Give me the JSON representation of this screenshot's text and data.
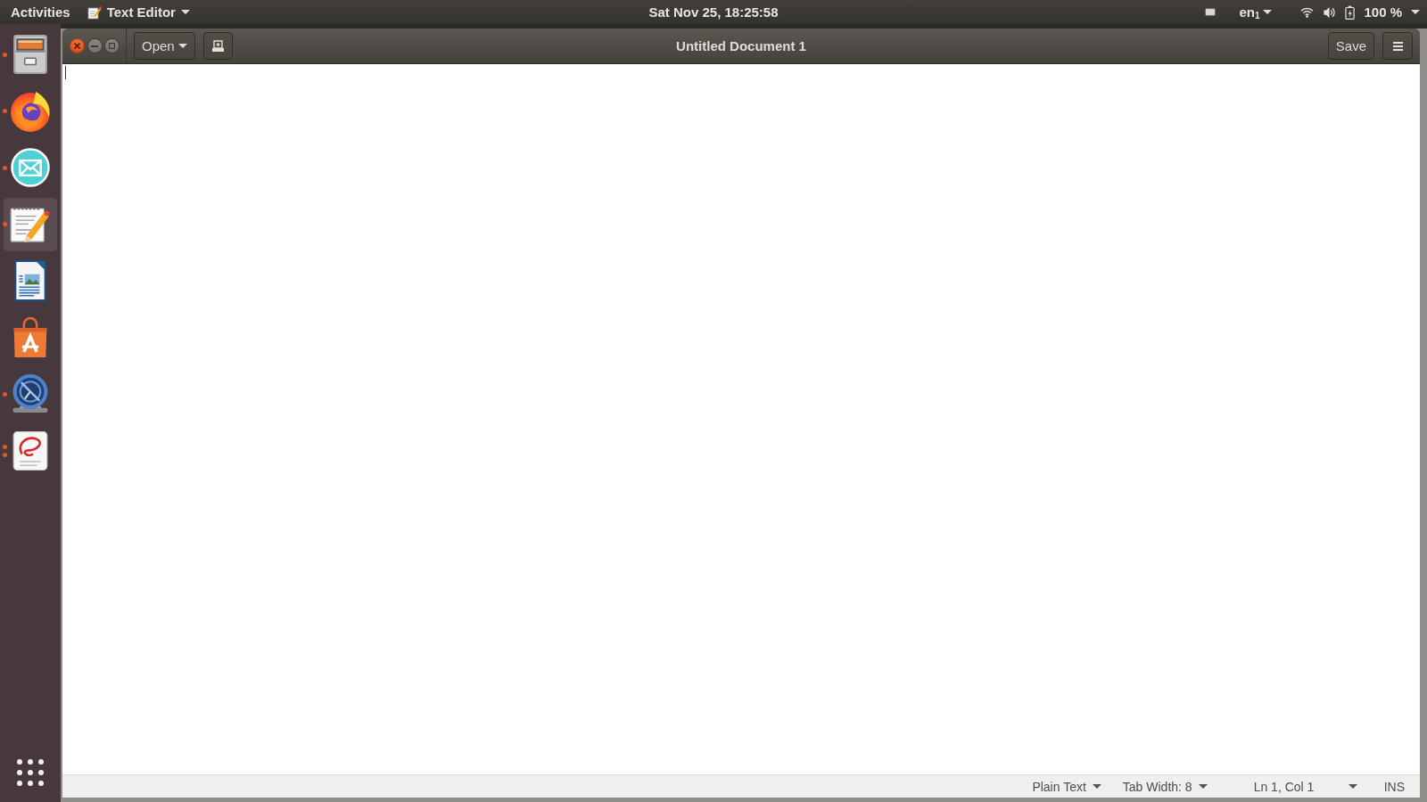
{
  "top_bar": {
    "activities": "Activities",
    "app_menu": "Text Editor",
    "clock": "Sat Nov 25, 18:25:58",
    "keyboard_layout": "en$_{1}$",
    "battery": "100 %"
  },
  "dock": {
    "items": [
      {
        "kind": "files",
        "running": true,
        "multiple_windows": false,
        "focused": false
      },
      {
        "kind": "browser",
        "running": true,
        "multiple_windows": false,
        "focused": false
      },
      {
        "kind": "mail",
        "running": true,
        "multiple_windows": false,
        "focused": false
      },
      {
        "kind": "text-editor",
        "running": true,
        "multiple_windows": false,
        "focused": true
      },
      {
        "kind": "writer",
        "running": false,
        "multiple_windows": false,
        "focused": false
      },
      {
        "kind": "store",
        "running": false,
        "multiple_windows": false,
        "focused": false
      },
      {
        "kind": "wheel",
        "running": true,
        "multiple_windows": false,
        "focused": false
      },
      {
        "kind": "reader",
        "running": true,
        "multiple_windows": true,
        "focused": false
      }
    ]
  },
  "window": {
    "open_button": "Open",
    "title": "Untitled Document 1",
    "save_button": "Save",
    "status_bar": {
      "language": "Plain Text",
      "tab_width": "Tab Width: 8",
      "cursor_position": "Ln 1, Col 1",
      "insert_mode": "INS"
    }
  }
}
